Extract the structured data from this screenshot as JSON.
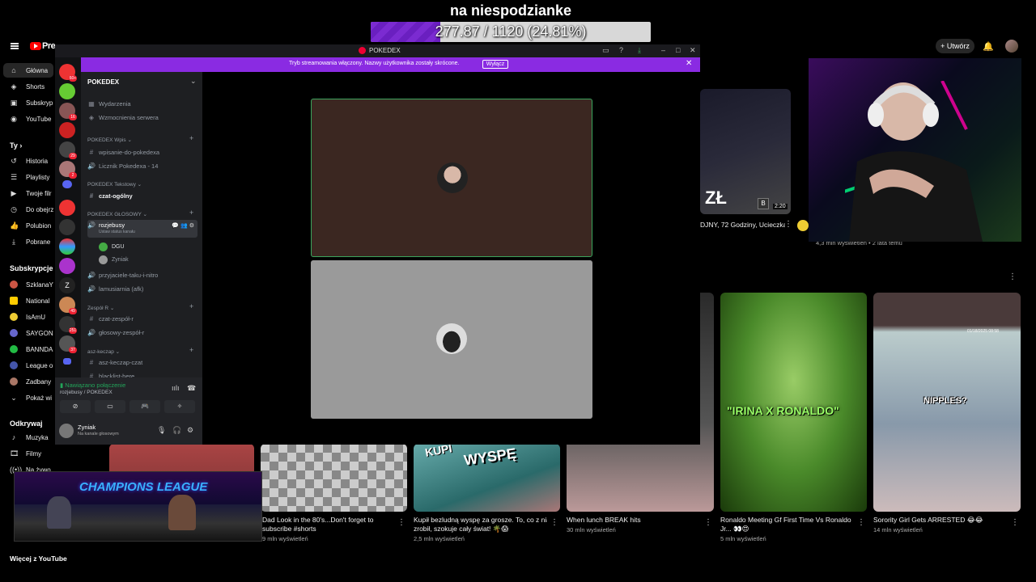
{
  "overlay": {
    "title": "na niespodzianke",
    "goal_text": "277.87 / 1120 (24.81%)",
    "goal_fraction": 0.2481
  },
  "youtube": {
    "logo_text": "Pre",
    "create_label": "Utwórz",
    "sidebar": {
      "home": "Główna",
      "shorts": "Shorts",
      "subs": "Subskryp",
      "youtube_you": "YouTube",
      "you_header": "Ty",
      "history": "Historia",
      "playlists": "Playlisty",
      "your_videos": "Twoje filr",
      "watch_later": "Do obejrz",
      "liked": "Polubion",
      "downloads": "Pobrane",
      "subs_header": "Subskrypcje",
      "sub_items": [
        "SzklanaY",
        "National",
        "IsAmU",
        "SAYGON",
        "BANNDA",
        "League o",
        "Zadbany"
      ],
      "show_more": "Pokaż wi",
      "explore_header": "Odkrywaj",
      "music": "Muzyka",
      "films": "Filmy",
      "live": "Na żywo",
      "more_from": "Więcej z YouTube"
    },
    "videos_top": [
      {
        "title": "DJNY, 72 Godziny, Ucieczka",
        "overlay_text": "ZŁ",
        "duration": "2:20",
        "views": "4,3 mln wyświetleń • 2 lata temu"
      }
    ],
    "videos_row": [
      {
        "title_line1": "Dad Look in the 80's...Don't forget to",
        "title_line2": "subscribe #shorts",
        "views": "9 mln wyświetleń"
      },
      {
        "title_line1": "Kupił bezludną wyspę za grosze. To, co z nią",
        "title_line2": "zrobił, szokuje cały świat! 🌴😱",
        "views": "2,5 mln wyświetleń",
        "overlay_text": "WYSPĘ",
        "overlay_text2": "KUPI"
      },
      {
        "title_line1": "When lunch BREAK hits",
        "title_line2": "",
        "views": "30 mln wyświetleń"
      },
      {
        "title_line1": "Ronaldo Meeting Gf First Time Vs Ronaldo",
        "title_line2": "Jr... 👀😍",
        "views": "5 mln wyświetleń",
        "overlay_text": "\"IRINA X RONALDO\""
      },
      {
        "title_line1": "Sorority Girl Gets ARRESTED 😂😂",
        "title_line2": "",
        "views": "14 mln wyświetleń",
        "overlay_text": "NIPPLES?",
        "timestamp": "01/18/2025 08:58"
      }
    ]
  },
  "discord": {
    "window_title": "POKEDEX",
    "banner_text": "Tryb streamowania włączony. Nazwy użytkownika zostały skrócone.",
    "banner_button": "Wyłącz",
    "server_name": "POKEDEX",
    "server_badges": [
      "60+",
      "16",
      "29",
      "2",
      "49",
      "251",
      "37",
      "271"
    ],
    "channels": {
      "events": "Wydarzenia",
      "boosts": "Wzmocnienia serwera",
      "cat_wpis": "POKEDEX Wpis",
      "wpisanie": "wpisanie-do-pokedexa",
      "licznik": "Licznik Pokedexa - 14",
      "cat_text": "POKEDEX Tekstowy",
      "czat": "czat-ogólny",
      "cat_voice": "POKEDEX GŁOSOWY",
      "rozjebusy": "rozjebusy",
      "rozjebusy_status": "Ustaw status kanału",
      "voice_users": [
        "DGU",
        "Zyniak"
      ],
      "przyjaciele": "przyjaciele-taku-i-nitro",
      "lamusiarnia": "lamusiarnia (afk)",
      "cat_zespol": "Zespół R",
      "czat_zespol": "czat-zespół-r",
      "glosowy_zespol": "głosowy-zespół-r",
      "cat_asz": "asz-keczap",
      "asz_czat": "asz-keczap-czat",
      "blacklist": "blacklist-here"
    },
    "voice_panel": {
      "status": "Nawiązano połączenie",
      "location": "rozjebusy / POKEDEX"
    },
    "user": {
      "name": "Zyniak",
      "status": "Na kanale głosowym"
    }
  },
  "bottom_cam": {
    "text": "CHAMPIONS LEAGUE"
  }
}
